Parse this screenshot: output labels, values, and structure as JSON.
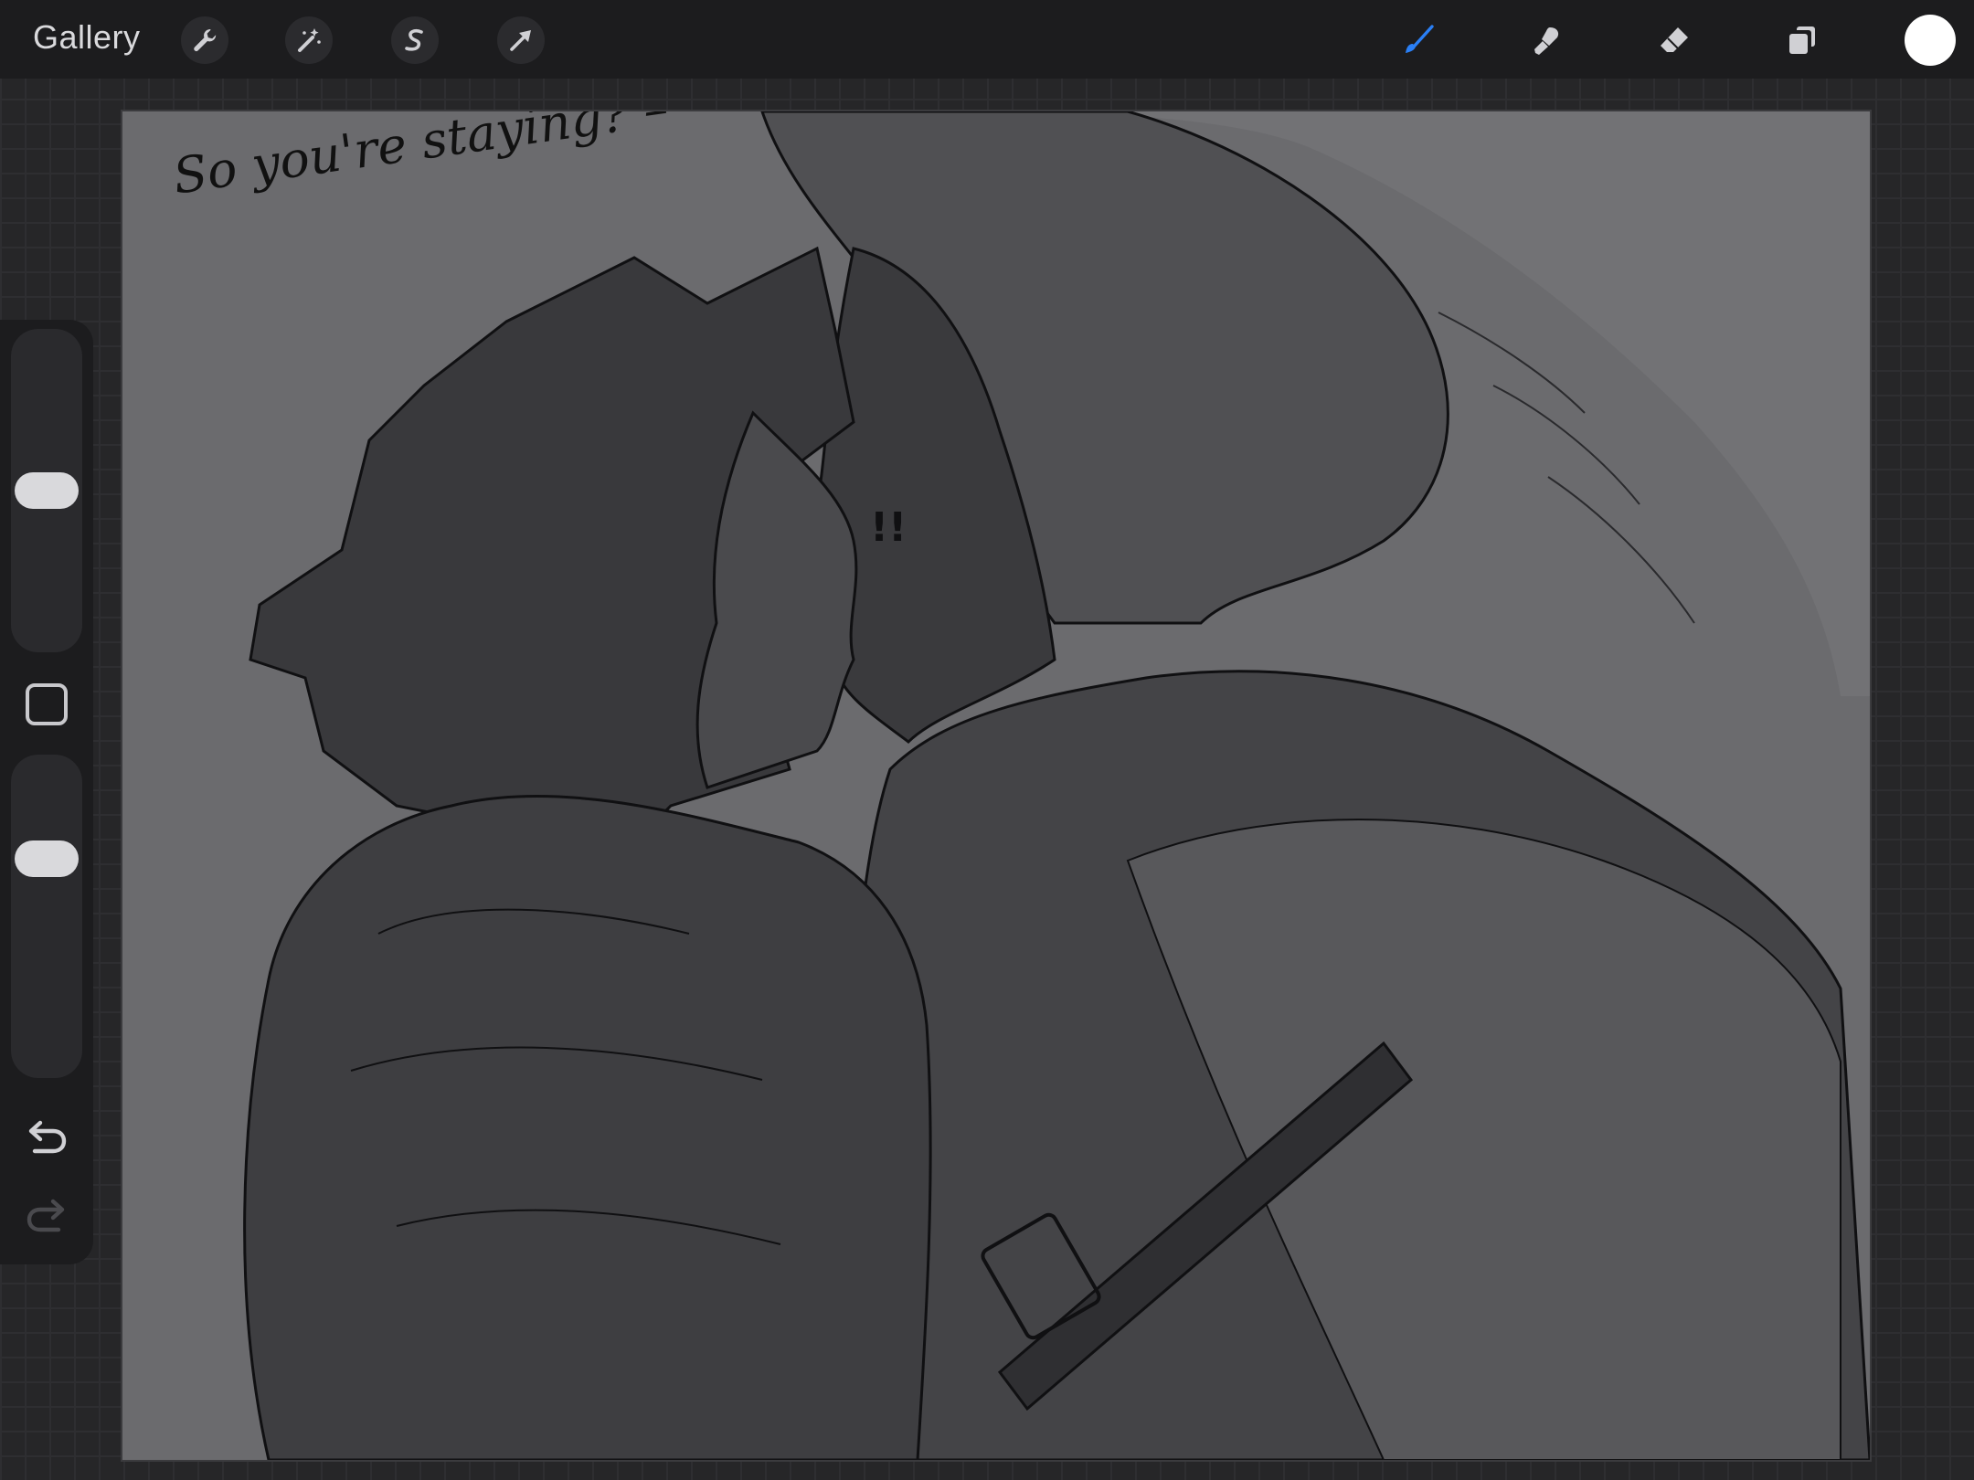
{
  "toolbar": {
    "gallery_label": "Gallery",
    "left_tools": [
      {
        "name": "actions",
        "icon": "wrench-icon"
      },
      {
        "name": "adjustments",
        "icon": "magic-wand-icon"
      },
      {
        "name": "selection",
        "icon": "selection-s-icon"
      },
      {
        "name": "transform",
        "icon": "arrow-cursor-icon"
      }
    ],
    "right_tools": [
      {
        "name": "brush",
        "icon": "brush-icon",
        "active": true
      },
      {
        "name": "smudge",
        "icon": "smudge-icon",
        "active": false
      },
      {
        "name": "eraser",
        "icon": "eraser-icon",
        "active": false
      },
      {
        "name": "layers",
        "icon": "layers-icon",
        "active": false
      }
    ],
    "active_color": "#ffffff",
    "active_tool_color": "#2a7ff5"
  },
  "sidebar": {
    "brush_size_level": 0.5,
    "opacity_level": 0.7,
    "controls": [
      "brush-size-slider",
      "modify-button",
      "opacity-slider",
      "undo-button",
      "redo-button"
    ]
  },
  "canvas": {
    "background_color": "#6b6b6e",
    "caption_text": "So you're staying? –",
    "exclamation_text": "!!"
  }
}
